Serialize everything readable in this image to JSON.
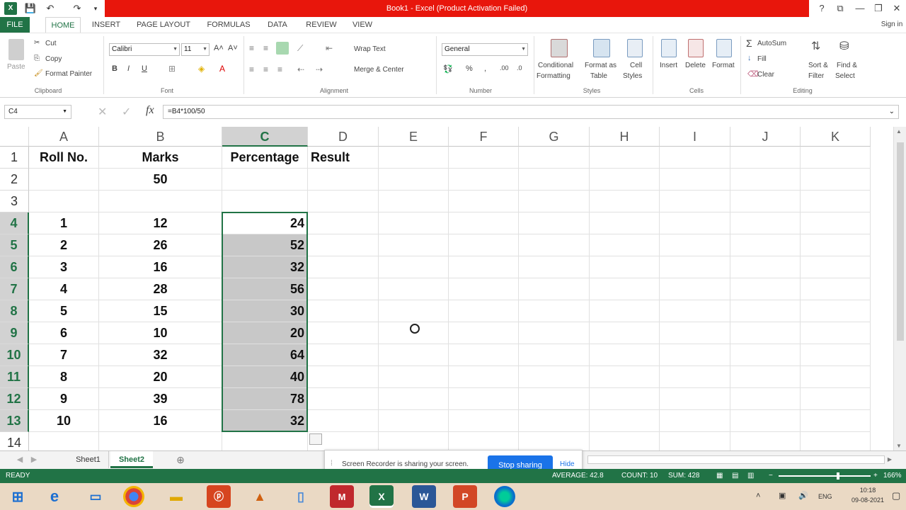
{
  "window": {
    "title": "Book1 - Excel (Product Activation Failed)",
    "signin": "Sign in"
  },
  "tabs": [
    "FILE",
    "HOME",
    "INSERT",
    "PAGE LAYOUT",
    "FORMULAS",
    "DATA",
    "REVIEW",
    "VIEW"
  ],
  "active_tab": "HOME",
  "ribbon": {
    "clipboard": {
      "paste": "Paste",
      "cut": "Cut",
      "copy": "Copy",
      "format_painter": "Format Painter",
      "label": "Clipboard"
    },
    "font": {
      "name": "Calibri",
      "size": "11",
      "label": "Font"
    },
    "alignment": {
      "wrap": "Wrap Text",
      "merge": "Merge & Center",
      "label": "Alignment"
    },
    "number": {
      "format": "General",
      "label": "Number"
    },
    "styles": {
      "cond1": "Conditional",
      "cond2": "Formatting",
      "fmt1": "Format as",
      "fmt2": "Table",
      "cell1": "Cell",
      "cell2": "Styles",
      "label": "Styles"
    },
    "cells": {
      "insert": "Insert",
      "delete": "Delete",
      "format": "Format",
      "label": "Cells"
    },
    "editing": {
      "autosum": "AutoSum",
      "fill": "Fill",
      "clear": "Clear",
      "sort1": "Sort &",
      "sort2": "Filter",
      "find1": "Find &",
      "find2": "Select",
      "label": "Editing"
    }
  },
  "formula_bar": {
    "name_box": "C4",
    "formula": "=B4*100/50"
  },
  "columns": [
    "A",
    "B",
    "C",
    "D",
    "E",
    "F",
    "G",
    "H",
    "I",
    "J",
    "K"
  ],
  "selected_column": "C",
  "rows": [
    {
      "num": "1",
      "A": "Roll No.",
      "B": "Marks",
      "C": "Percentage",
      "D": "Result"
    },
    {
      "num": "2",
      "A": "",
      "B": "50",
      "C": "",
      "D": ""
    },
    {
      "num": "3",
      "A": "",
      "B": "",
      "C": "",
      "D": ""
    },
    {
      "num": "4",
      "A": "1",
      "B": "12",
      "C": "24",
      "D": ""
    },
    {
      "num": "5",
      "A": "2",
      "B": "26",
      "C": "52",
      "D": ""
    },
    {
      "num": "6",
      "A": "3",
      "B": "16",
      "C": "32",
      "D": ""
    },
    {
      "num": "7",
      "A": "4",
      "B": "28",
      "C": "56",
      "D": ""
    },
    {
      "num": "8",
      "A": "5",
      "B": "15",
      "C": "30",
      "D": ""
    },
    {
      "num": "9",
      "A": "6",
      "B": "10",
      "C": "20",
      "D": ""
    },
    {
      "num": "10",
      "A": "7",
      "B": "32",
      "C": "64",
      "D": ""
    },
    {
      "num": "11",
      "A": "8",
      "B": "20",
      "C": "40",
      "D": ""
    },
    {
      "num": "12",
      "A": "9",
      "B": "39",
      "C": "78",
      "D": ""
    },
    {
      "num": "13",
      "A": "10",
      "B": "16",
      "C": "32",
      "D": ""
    },
    {
      "num": "14",
      "A": "",
      "B": "",
      "C": "",
      "D": ""
    }
  ],
  "sheets": [
    "Sheet1",
    "Sheet2"
  ],
  "active_sheet": "Sheet2",
  "share_banner": {
    "text": "Screen Recorder is sharing your screen.",
    "stop": "Stop sharing",
    "hide": "Hide"
  },
  "status": {
    "ready": "READY",
    "average": "AVERAGE: 42.8",
    "count": "COUNT: 10",
    "sum": "SUM: 428",
    "zoom": "166%"
  },
  "taskbar": {
    "lang": "ENG",
    "time": "10:18",
    "date": "09-08-2021"
  },
  "colors": {
    "excel_green": "#217346",
    "title_red": "#e8160c",
    "selection_fill": "#c8c8c8",
    "taskbar": "#ead9c4"
  }
}
